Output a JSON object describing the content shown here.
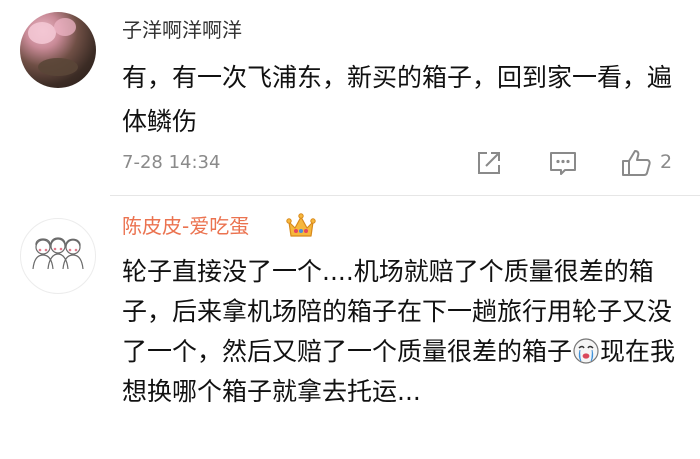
{
  "comments": [
    {
      "username": "子洋啊洋啊洋",
      "text": "有，有一次飞浦东，新买的箱子，回到家一看，遍体鳞伤",
      "time": "7-28 14:34",
      "like_count": "2",
      "avatar_icon": "user-avatar-photo"
    },
    {
      "username": "陈皮皮-爱吃蛋",
      "badge_icon": "crown-icon",
      "text_before_emoji": "轮子直接没了一个....机场就赔了个质量很差的箱子，后来拿机场陪的箱子在下一趟旅行用轮子又没了一个，然后又赔了一个质量很差的箱子",
      "emoji_icon": "crying-face-emoji",
      "text_after_emoji": "现在我想换哪个箱子就拿去托运...",
      "avatar_icon": "user-avatar-drawing"
    }
  ],
  "actions": {
    "forward_icon": "forward-icon",
    "comment_icon": "comment-icon",
    "like_icon": "thumbs-up-icon"
  },
  "colors": {
    "username_vip": "#eb7350",
    "username": "#333333",
    "text": "#111111",
    "meta": "#8a8a8a"
  }
}
